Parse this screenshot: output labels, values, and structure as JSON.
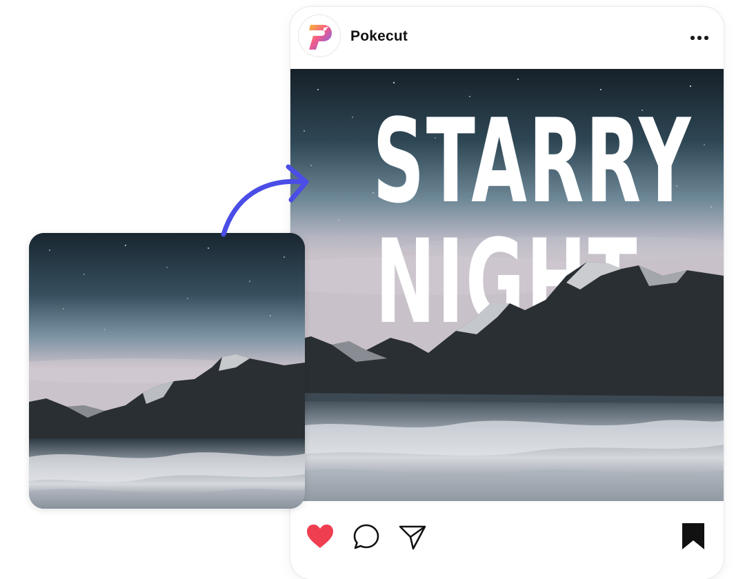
{
  "post": {
    "username": "Pokecut",
    "headline_line1": "STARRY",
    "headline_line2": "NIGHT"
  },
  "icons": {
    "avatar": "pokecut-logo-icon",
    "more": "more-options-icon",
    "like": "heart-icon",
    "comment": "comment-icon",
    "share": "send-icon",
    "save": "bookmark-icon",
    "arrow": "curved-arrow-icon"
  },
  "colors": {
    "like": "#ee3e4f",
    "arrow": "#4a4de6",
    "text": "#111111"
  }
}
